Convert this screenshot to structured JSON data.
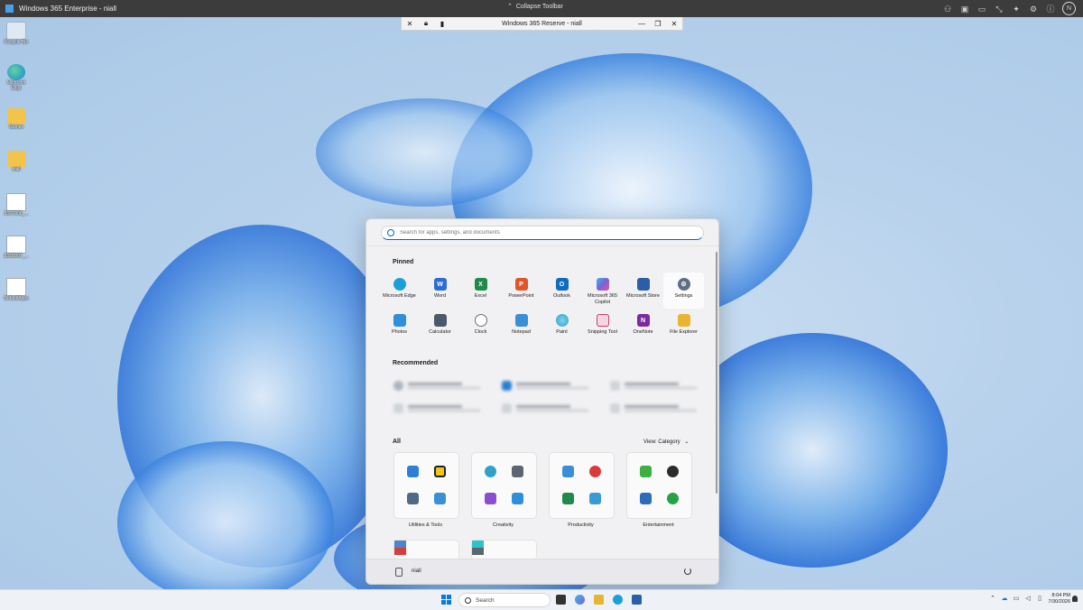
{
  "host": {
    "title": "Windows 365 Enterprise - niall",
    "collapse_label": "Collapse Toolbar",
    "avatar_initial": "N"
  },
  "remote_toolbar": {
    "title": "Windows 365 Reserve - niall"
  },
  "desktop_icons": [
    {
      "label": "Recycle Bin",
      "icon": "recycle-bin-icon"
    },
    {
      "label": "Microsoft Edge",
      "icon": "edge-icon"
    },
    {
      "label": "Games",
      "icon": "folder-icon"
    },
    {
      "label": "niall",
      "icon": "folder-icon"
    },
    {
      "label": "3337D08_...",
      "icon": "image-file-icon"
    },
    {
      "label": "8330D87_...",
      "icon": "image-file-icon"
    },
    {
      "label": "DefaultApps",
      "icon": "text-file-icon"
    }
  ],
  "start_menu": {
    "search_placeholder": "Search for apps, settings, and documents",
    "pinned_header": "Pinned",
    "pinned": [
      {
        "label": "Microsoft Edge",
        "icon": "edge-icon",
        "color": "#1aa0d8"
      },
      {
        "label": "Word",
        "icon": "word-icon",
        "color": "#2b6cd4"
      },
      {
        "label": "Excel",
        "icon": "excel-icon",
        "color": "#1f8a4c"
      },
      {
        "label": "PowerPoint",
        "icon": "powerpoint-icon",
        "color": "#e0562a"
      },
      {
        "label": "Outlook",
        "icon": "outlook-icon",
        "color": "#0f6cbd"
      },
      {
        "label": "Microsoft 365 Copilot",
        "icon": "copilot-icon",
        "color": "#7b61d9"
      },
      {
        "label": "Microsoft Store",
        "icon": "store-icon",
        "color": "#2a5fa8"
      },
      {
        "label": "Settings",
        "icon": "settings-icon",
        "color": "#5c6f86"
      },
      {
        "label": "Photos",
        "icon": "photos-icon",
        "color": "#2f8fd8"
      },
      {
        "label": "Calculator",
        "icon": "calculator-icon",
        "color": "#4a5a6a"
      },
      {
        "label": "Clock",
        "icon": "clock-icon",
        "color": "#6a6f75"
      },
      {
        "label": "Notepad",
        "icon": "notepad-icon",
        "color": "#3b8fd6"
      },
      {
        "label": "Paint",
        "icon": "paint-icon",
        "color": "#32a0c8"
      },
      {
        "label": "Snipping Tool",
        "icon": "snipping-tool-icon",
        "color": "#c8406a"
      },
      {
        "label": "OneNote",
        "icon": "onenote-icon",
        "color": "#7a2c9e"
      },
      {
        "label": "File Explorer",
        "icon": "file-explorer-icon",
        "color": "#e7b532"
      }
    ],
    "recommended_header": "Recommended",
    "all_header": "All",
    "view_category": "View: Category",
    "categories": [
      {
        "label": "Utilities & Tools",
        "colors": [
          "#2f7fd6",
          "#f2c618",
          "#4d6a86",
          "#3a8fd6"
        ]
      },
      {
        "label": "Creativity",
        "colors": [
          "#2ea2c7",
          "#5b6670",
          "#8a4fd0",
          "#2f8fd8"
        ]
      },
      {
        "label": "Productivity",
        "colors": [
          "#3b8fd6",
          "#d83b3b",
          "#1f8a4c",
          "#3a9ad6"
        ]
      },
      {
        "label": "Entertainment",
        "colors": [
          "#3cb043",
          "#2b2b2b",
          "#2c6cb8",
          "#25a244"
        ]
      }
    ],
    "user_name": "niall"
  },
  "taskbar": {
    "search_label": "Search",
    "time": "8:04 PM",
    "date": "7/30/2026"
  }
}
